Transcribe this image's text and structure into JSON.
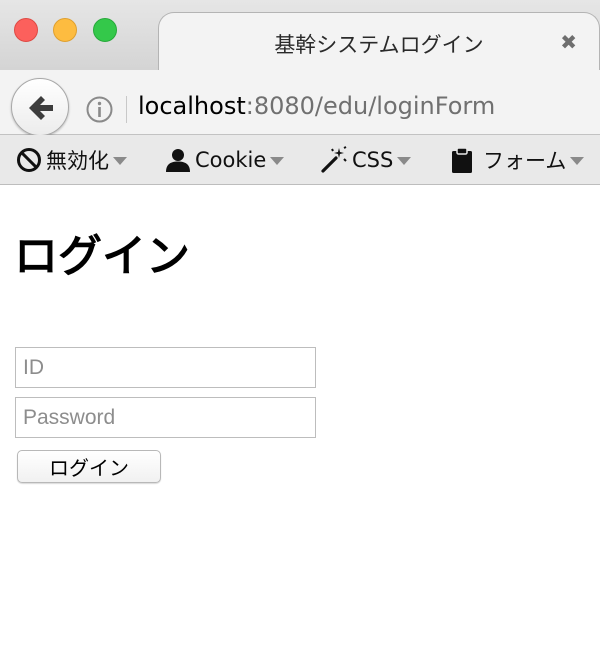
{
  "window": {
    "tab_title": "基幹システムログイン",
    "tab_close_glyph": "✖",
    "traffic_colors": {
      "close": "#fc605c",
      "minimize": "#fdbc40",
      "maximize": "#34c84a"
    }
  },
  "navbar": {
    "url_host": "localhost",
    "url_rest": ":8080/edu/loginForm",
    "back_icon": "arrow-left-icon",
    "info_icon": "info-circle-icon"
  },
  "extension_toolbar": {
    "items": [
      {
        "label": "無効化",
        "icon": "prohibited-icon"
      },
      {
        "label": "Cookie",
        "icon": "user-silhouette-icon"
      },
      {
        "label": "CSS",
        "icon": "magic-wand-icon"
      },
      {
        "label": "フォーム",
        "icon": "clipboard-icon"
      }
    ]
  },
  "page": {
    "heading": "ログイン",
    "id_placeholder": "ID",
    "password_placeholder": "Password",
    "login_button": "ログイン"
  }
}
